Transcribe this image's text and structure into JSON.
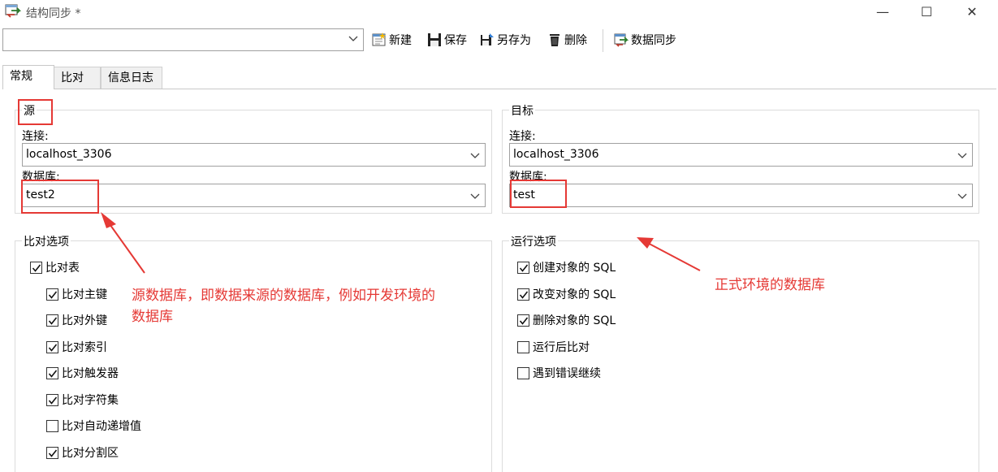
{
  "window": {
    "title": "结构同步 *",
    "controls": {
      "minimize": "—",
      "maximize": "☐",
      "close": "✕"
    }
  },
  "toolbar": {
    "profile_value": "",
    "new_label": "新建",
    "save_label": "保存",
    "save_as_label": "另存为",
    "delete_label": "删除",
    "sync_label": "数据同步"
  },
  "tabs": [
    {
      "label": "常规",
      "active": true
    },
    {
      "label": "比对",
      "active": false
    },
    {
      "label": "信息日志",
      "active": false
    }
  ],
  "source": {
    "title": "源",
    "connection_label": "连接:",
    "connection_value": "localhost_3306",
    "database_label": "数据库:",
    "database_value": "test2"
  },
  "target": {
    "title": "目标",
    "connection_label": "连接:",
    "connection_value": "localhost_3306",
    "database_label": "数据库:",
    "database_value": "test"
  },
  "compare_options": {
    "title": "比对选项",
    "items": [
      {
        "label": "比对表",
        "checked": true
      },
      {
        "label": "比对主键",
        "checked": true
      },
      {
        "label": "比对外键",
        "checked": true
      },
      {
        "label": "比对索引",
        "checked": true
      },
      {
        "label": "比对触发器",
        "checked": true
      },
      {
        "label": "比对字符集",
        "checked": true
      },
      {
        "label": "比对自动递增值",
        "checked": false
      },
      {
        "label": "比对分割区",
        "checked": true
      }
    ]
  },
  "run_options": {
    "title": "运行选项",
    "items": [
      {
        "label": "创建对象的 SQL",
        "checked": true
      },
      {
        "label": "改变对象的 SQL",
        "checked": true
      },
      {
        "label": "删除对象的 SQL",
        "checked": true
      },
      {
        "label": "运行后比对",
        "checked": false
      },
      {
        "label": "遇到错误继续",
        "checked": false
      }
    ]
  },
  "annotations": {
    "source_note_line1": "源数据库，即数据来源的数据库，例如开发环境的",
    "source_note_line2": "数据库",
    "target_note": "正式环境的数据库",
    "color": "#e53935"
  }
}
